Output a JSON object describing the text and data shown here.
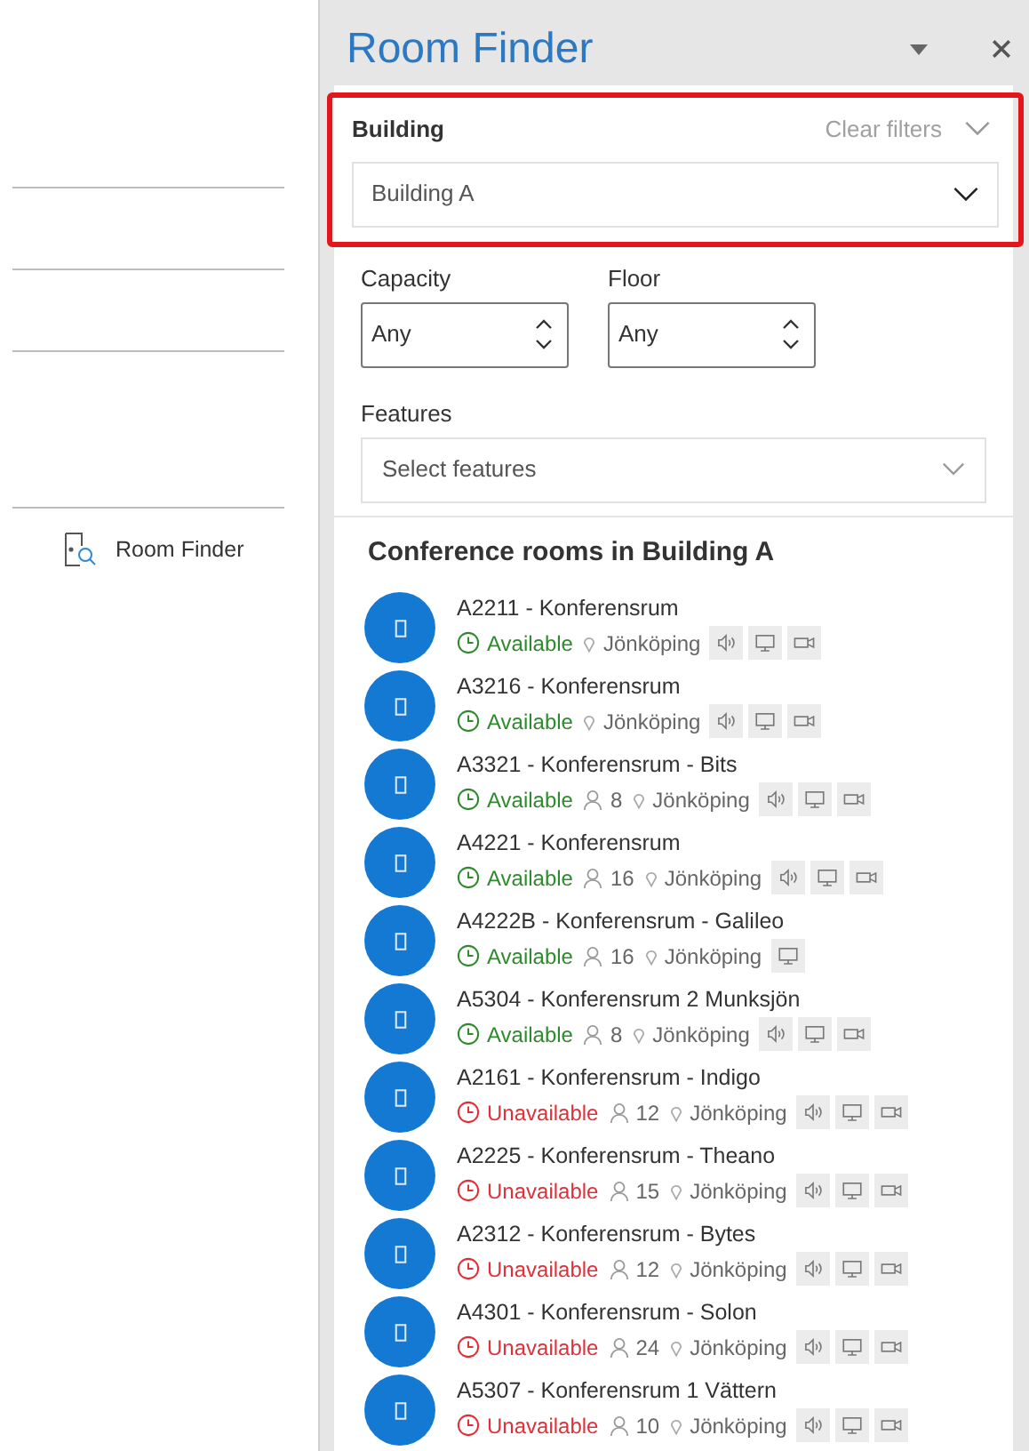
{
  "left_pane": {
    "command": "Room Finder"
  },
  "panel": {
    "title": "Room Finder"
  },
  "filters": {
    "building_label": "Building",
    "clear_filters": "Clear filters",
    "building_value": "Building A",
    "capacity_label": "Capacity",
    "capacity_value": "Any",
    "floor_label": "Floor",
    "floor_value": "Any",
    "features_label": "Features",
    "features_placeholder": "Select features"
  },
  "results": {
    "heading": "Conference rooms in Building A",
    "rooms": [
      {
        "name": "A2211 - Konferensrum",
        "available": true,
        "status": "Available",
        "location": "Jönköping",
        "audio": true,
        "display": true,
        "video": true
      },
      {
        "name": "A3216 - Konferensrum",
        "available": true,
        "status": "Available",
        "location": "Jönköping",
        "audio": true,
        "display": true,
        "video": true
      },
      {
        "name": "A3321 - Konferensrum - Bits",
        "available": true,
        "status": "Available",
        "capacity": "8",
        "location": "Jönköping",
        "audio": true,
        "display": true,
        "video": true
      },
      {
        "name": "A4221 - Konferensrum",
        "available": true,
        "status": "Available",
        "capacity": "16",
        "location": "Jönköping",
        "audio": true,
        "display": true,
        "video": true
      },
      {
        "name": "A4222B - Konferensrum - Galileo",
        "available": true,
        "status": "Available",
        "capacity": "16",
        "location": "Jönköping",
        "audio": false,
        "display": true,
        "video": false
      },
      {
        "name": "A5304 - Konferensrum 2 Munksjön",
        "available": true,
        "status": "Available",
        "capacity": "8",
        "location": "Jönköping",
        "audio": true,
        "display": true,
        "video": true
      },
      {
        "name": "A2161 - Konferensrum - Indigo",
        "available": false,
        "status": "Unavailable",
        "capacity": "12",
        "location": "Jönköping",
        "audio": true,
        "display": true,
        "video": true
      },
      {
        "name": "A2225 - Konferensrum - Theano",
        "available": false,
        "status": "Unavailable",
        "capacity": "15",
        "location": "Jönköping",
        "audio": true,
        "display": true,
        "video": true
      },
      {
        "name": "A2312 - Konferensrum - Bytes",
        "available": false,
        "status": "Unavailable",
        "capacity": "12",
        "location": "Jönköping",
        "audio": true,
        "display": true,
        "video": true
      },
      {
        "name": "A4301 - Konferensrum - Solon",
        "available": false,
        "status": "Unavailable",
        "capacity": "24",
        "location": "Jönköping",
        "audio": true,
        "display": true,
        "video": true
      },
      {
        "name": "A5307 - Konferensrum 1 Vättern",
        "available": false,
        "status": "Unavailable",
        "capacity": "10",
        "location": "Jönköping",
        "audio": true,
        "display": true,
        "video": true
      }
    ]
  }
}
